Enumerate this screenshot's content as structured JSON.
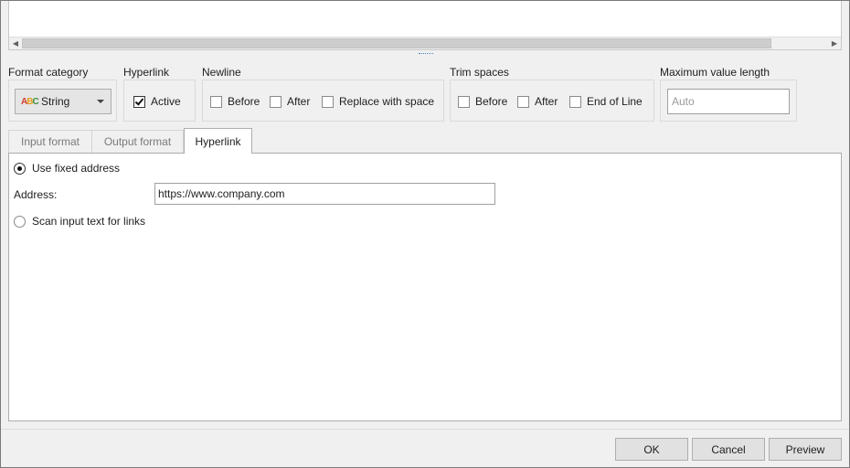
{
  "format_category": {
    "label": "Format category",
    "value": "String",
    "icon": "abc-string-icon"
  },
  "hyperlink_group": {
    "label": "Hyperlink",
    "active": {
      "label": "Active",
      "checked": true
    }
  },
  "newline": {
    "label": "Newline",
    "before": {
      "label": "Before",
      "checked": false
    },
    "after": {
      "label": "After",
      "checked": false
    },
    "replace": {
      "label": "Replace with space",
      "checked": false
    }
  },
  "trim_spaces": {
    "label": "Trim spaces",
    "before": {
      "label": "Before",
      "checked": false
    },
    "after": {
      "label": "After",
      "checked": false
    },
    "end_of_line": {
      "label": "End of Line",
      "checked": false
    }
  },
  "max_length": {
    "label": "Maximum value length",
    "placeholder": "Auto",
    "value": ""
  },
  "tabs": [
    {
      "label": "Input format",
      "active": false
    },
    {
      "label": "Output format",
      "active": false
    },
    {
      "label": "Hyperlink",
      "active": true
    }
  ],
  "hyperlink_panel": {
    "use_fixed_label": "Use fixed address",
    "use_fixed_selected": true,
    "address_label": "Address:",
    "address_value": "https://www.company.com",
    "scan_label": "Scan input text for links",
    "scan_selected": false
  },
  "buttons": {
    "ok": "OK",
    "cancel": "Cancel",
    "preview": "Preview"
  }
}
